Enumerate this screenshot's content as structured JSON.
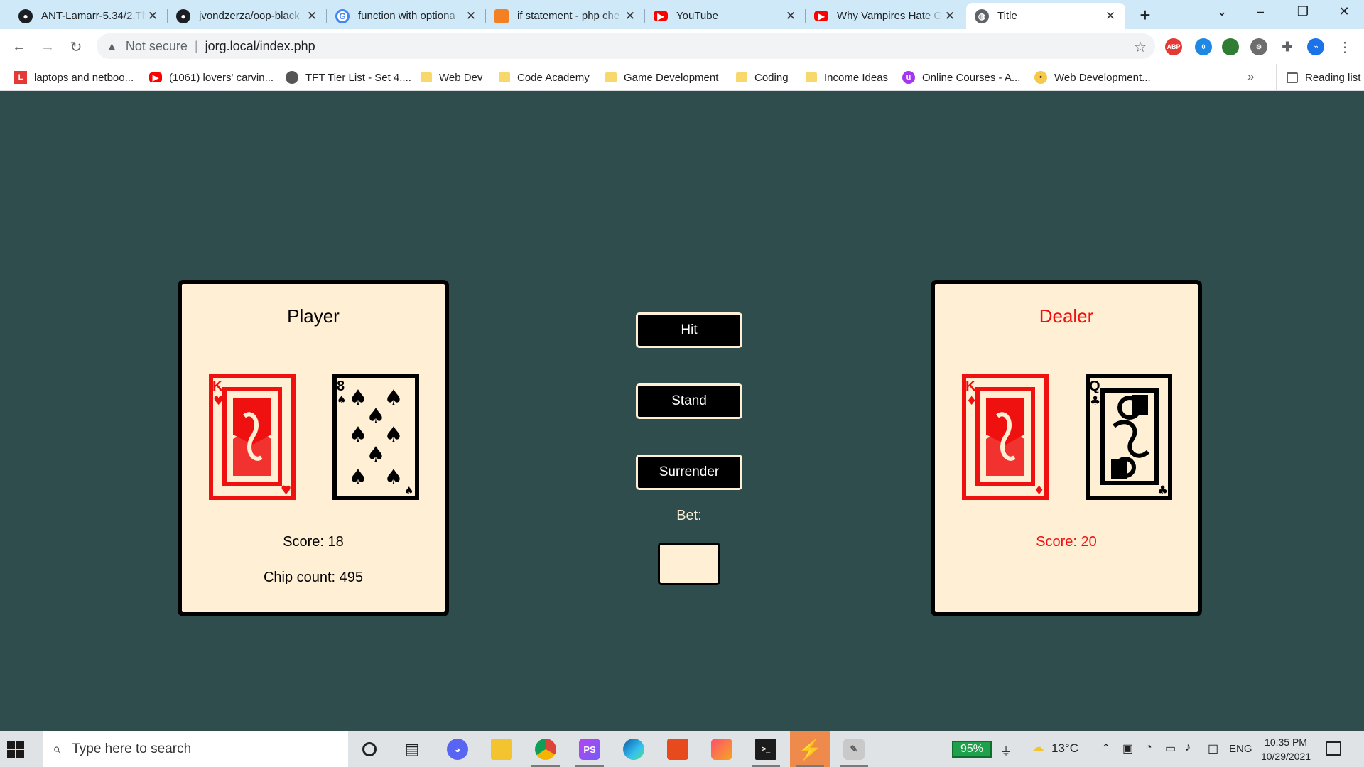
{
  "browser": {
    "tabs": [
      {
        "title": "ANT-Lamarr-5.34/2.Th",
        "icon": "github-icon",
        "active": false
      },
      {
        "title": "jvondzerza/oop-black",
        "icon": "github-icon",
        "active": false
      },
      {
        "title": "function with optiona",
        "icon": "google-icon",
        "active": false
      },
      {
        "title": "if statement - php che",
        "icon": "stackoverflow-icon",
        "active": false
      },
      {
        "title": "YouTube",
        "icon": "youtube-icon",
        "active": false
      },
      {
        "title": "Why Vampires Hate G",
        "icon": "youtube-icon",
        "active": false
      },
      {
        "title": "Title",
        "icon": "globe-icon",
        "active": true
      }
    ],
    "security_label": "Not secure",
    "url": "jorg.local/index.php",
    "bookmarks": [
      {
        "label": "laptops and netboo...",
        "icon": "l-icon"
      },
      {
        "label": "(1061) lovers' carvin...",
        "icon": "youtube-icon"
      },
      {
        "label": "TFT Tier List - Set 4....",
        "icon": "tft-icon"
      },
      {
        "label": "Web Dev",
        "icon": "folder-icon"
      },
      {
        "label": "Code Academy",
        "icon": "folder-icon"
      },
      {
        "label": "Game Development",
        "icon": "folder-icon"
      },
      {
        "label": "Coding",
        "icon": "folder-icon"
      },
      {
        "label": "Income Ideas",
        "icon": "folder-icon"
      },
      {
        "label": "Online Courses - A...",
        "icon": "udemy-icon"
      },
      {
        "label": "Web Development...",
        "icon": "web-icon"
      }
    ],
    "reading_list": "Reading list",
    "extension_badge": "0",
    "adblock_label": "ABP"
  },
  "game": {
    "player": {
      "title": "Player",
      "score_text": "Score: 18",
      "chips_text": "Chip count: 495",
      "cards": [
        {
          "name": "king-of-hearts",
          "rank": "K",
          "suit": "♥",
          "color": "#ef1010"
        },
        {
          "name": "eight-of-spades",
          "rank": "8",
          "suit": "♠",
          "color": "#000000"
        }
      ]
    },
    "dealer": {
      "title": "Dealer",
      "score_text": "Score: 20",
      "cards": [
        {
          "name": "king-of-diamonds",
          "rank": "K",
          "suit": "♦",
          "color": "#ef1010"
        },
        {
          "name": "queen-of-clubs",
          "rank": "Q",
          "suit": "♣",
          "color": "#000000"
        }
      ]
    },
    "buttons": {
      "hit": "Hit",
      "stand": "Stand",
      "surrender": "Surrender"
    },
    "bet_label": "Bet:",
    "bet_value": ""
  },
  "taskbar": {
    "search_placeholder": "Type here to search",
    "battery": "95%",
    "temperature": "13°C",
    "language": "ENG",
    "time": "10:35 PM",
    "date": "10/29/2021"
  },
  "colors": {
    "page_bg": "#2f4d4d",
    "panel_bg": "#ffefd5",
    "dealer_red": "#ef1010"
  }
}
